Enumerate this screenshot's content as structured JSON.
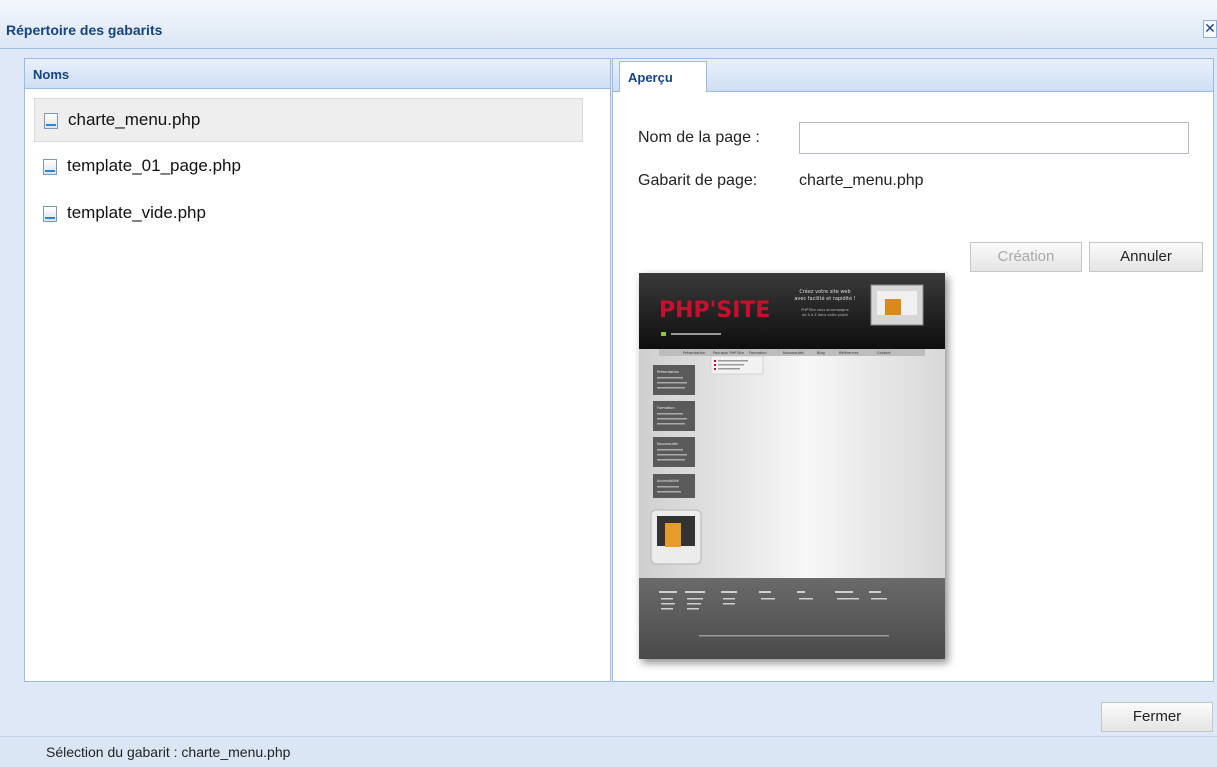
{
  "window": {
    "title": "Répertoire des gabarits",
    "close_glyph": "✕"
  },
  "left_panel": {
    "header": "Noms",
    "items": [
      {
        "label": "charte_menu.php",
        "selected": true
      },
      {
        "label": "template_01_page.php",
        "selected": false
      },
      {
        "label": "template_vide.php",
        "selected": false
      }
    ]
  },
  "right_panel": {
    "tab": "Aperçu",
    "page_name_label": "Nom de la page :",
    "page_name_value": "",
    "template_label": "Gabarit de page:",
    "template_value": "charte_menu.php",
    "create_button": "Création",
    "cancel_button": "Annuler"
  },
  "preview": {
    "logo_text": "PHP'SITE",
    "tagline_lines": [
      "Créez votre site web",
      "avec facilité et rapidité !"
    ],
    "sub_lines": [
      "PHP'Site vous accompagne",
      "de A à Z dans votre projet"
    ],
    "nav_items": [
      "Présentation",
      "Pourquoi PHP'Site",
      "Formation",
      "Nouveautés",
      "Blog",
      "Références",
      "Contact"
    ],
    "sidebar_blocks": [
      "Présentation",
      "Formation",
      "Nouveautés",
      "Accessibilité"
    ],
    "colors": {
      "header": "#1e1e1e",
      "logo_red": "#c8102e",
      "footer": "#5c5c5c"
    }
  },
  "footer": {
    "close_button": "Fermer"
  },
  "status": {
    "text": "Sélection du gabarit : charte_menu.php"
  }
}
